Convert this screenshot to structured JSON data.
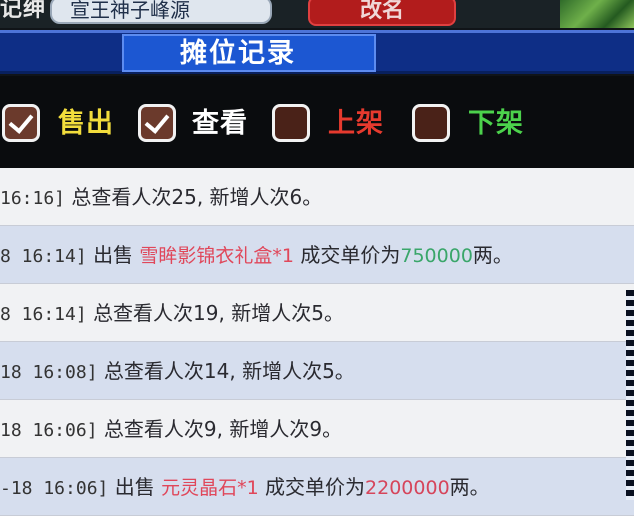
{
  "top_bar": {
    "left_fragment": "记绅",
    "search_text": "宣王神子峰源",
    "button_label": "改名"
  },
  "window": {
    "title": "摊位记录"
  },
  "filters": [
    {
      "label": "售出",
      "checked": true,
      "color": "#f2dd3c"
    },
    {
      "label": "查看",
      "checked": true,
      "color": "#ffffff"
    },
    {
      "label": "上架",
      "checked": false,
      "color": "#e63a2e"
    },
    {
      "label": "下架",
      "checked": false,
      "color": "#4cd24c"
    }
  ],
  "records": [
    {
      "time": "16:16]",
      "style": "light",
      "type": "view",
      "text": "总查看人次25, 新增人次6。"
    },
    {
      "time": "8 16:14]",
      "style": "blue",
      "type": "sale",
      "action": "出售",
      "item": "雪眸影锦衣礼盒*1",
      "unit_label": "成交单价为",
      "price": "750000",
      "currency": "两。",
      "price_color": "green"
    },
    {
      "time": "8 16:14]",
      "style": "light",
      "type": "view",
      "text": "总查看人次19, 新增人次5。"
    },
    {
      "time": "18 16:08]",
      "style": "blue",
      "type": "view",
      "text": "总查看人次14, 新增人次5。"
    },
    {
      "time": "18 16:06]",
      "style": "light",
      "type": "view",
      "text": "总查看人次9, 新增人次9。"
    },
    {
      "time": "-18 16:06]",
      "style": "blue",
      "type": "sale",
      "action": "出售",
      "item": "元灵晶石*1",
      "unit_label": "成交单价为",
      "price": "2200000",
      "currency": "两。",
      "price_color": "red"
    }
  ]
}
